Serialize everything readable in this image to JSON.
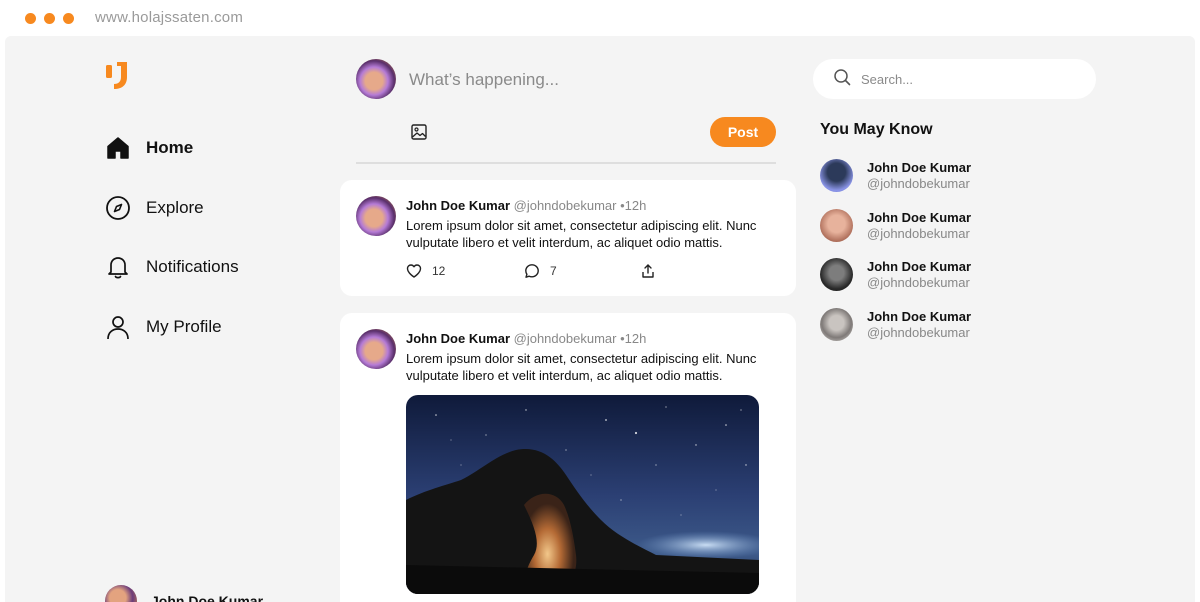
{
  "browser": {
    "url": "www.holajssaten.com"
  },
  "nav": {
    "items": [
      {
        "label": "Home",
        "icon": "home-icon"
      },
      {
        "label": "Explore",
        "icon": "compass-icon"
      },
      {
        "label": "Notifications",
        "icon": "bell-icon"
      },
      {
        "label": "My Profile",
        "icon": "user-icon"
      }
    ],
    "user": {
      "name": "John Doe Kumar"
    }
  },
  "composer": {
    "placeholder": "What’s happening...",
    "post_label": "Post"
  },
  "posts": [
    {
      "name": "John Doe Kumar",
      "handle": "@johndobekumar",
      "time": "12h",
      "text": "Lorem ipsum dolor sit amet, consectetur adipiscing elit. Nunc vulputate libero et velit interdum, ac aliquet odio mattis.",
      "likes": "12",
      "comments": "7"
    },
    {
      "name": "John Doe Kumar",
      "handle": "@johndobekumar",
      "time": "12h",
      "text": "Lorem ipsum dolor sit amet, consectetur adipiscing elit. Nunc vulputate libero et velit interdum, ac aliquet odio mattis."
    }
  ],
  "search": {
    "placeholder": "Search..."
  },
  "suggestions": {
    "title": "You May Know",
    "people": [
      {
        "name": "John Doe Kumar",
        "handle": "@johndobekumar"
      },
      {
        "name": "John Doe Kumar",
        "handle": "@johndobekumar"
      },
      {
        "name": "John Doe Kumar",
        "handle": "@johndobekumar"
      },
      {
        "name": "John Doe Kumar",
        "handle": "@johndobekumar"
      }
    ]
  },
  "colors": {
    "accent": "#f7891f",
    "background": "#f4f4f4"
  }
}
